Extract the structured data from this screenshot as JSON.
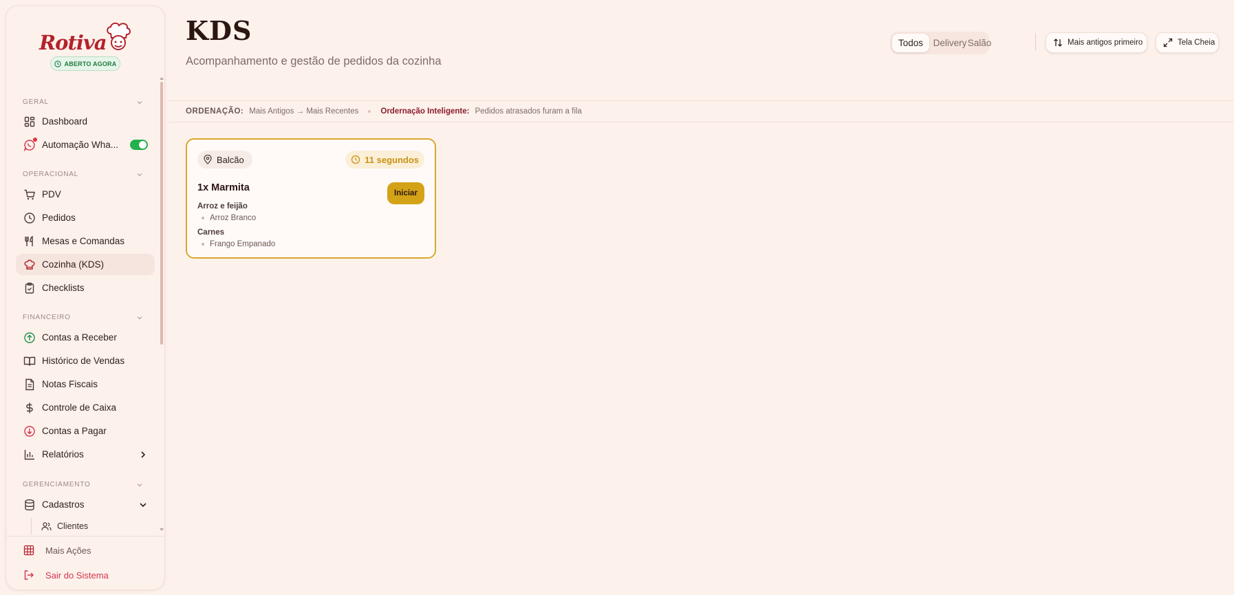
{
  "sidebar": {
    "brand": "Rotiva",
    "status_badge": "ABERTO AGORA",
    "sections": {
      "geral": "GERAL",
      "operacional": "OPERACIONAL",
      "financeiro": "FINANCEIRO",
      "gerenciamento": "GERENCIAMENTO"
    },
    "items": {
      "dashboard": "Dashboard",
      "whatsapp": "Automação Wha...",
      "pdv": "PDV",
      "pedidos": "Pedidos",
      "mesas": "Mesas e Comandas",
      "cozinha": "Cozinha (KDS)",
      "checklists": "Checklists",
      "receber": "Contas a Receber",
      "historico": "Histórico de Vendas",
      "notas": "Notas Fiscais",
      "caixa": "Controle de Caixa",
      "pagar": "Contas a Pagar",
      "relatorios": "Relatórios",
      "cadastros": "Cadastros",
      "clientes": "Clientes"
    },
    "whatsapp_enabled": true,
    "footer": {
      "more": "Mais Ações",
      "logout": "Sair do Sistema"
    }
  },
  "header": {
    "title": "KDS",
    "subtitle": "Acompanhamento e gestão de pedidos da cozinha",
    "filters": [
      "Todos",
      "Delivery",
      "Salão"
    ],
    "selected_filter": "Todos",
    "sort_label": "Mais antigos primeiro",
    "fullscreen_label": "Tela Cheia"
  },
  "ordering": {
    "label": "ORDENAÇÃO:",
    "value": "Mais Antigos → Mais Recentes",
    "smart_label": "Ordernação Inteligente:",
    "smart_value": "Pedidos atrasados furam a fila"
  },
  "order_card": {
    "location": "Balcão",
    "elapsed": "11 segundos",
    "item": "1x Marmita",
    "start_label": "Iniciar",
    "groups": [
      {
        "name": "Arroz e feijão",
        "option": "Arroz Branco"
      },
      {
        "name": "Carnes",
        "option": "Frango Empanado"
      }
    ]
  },
  "colors": {
    "accent": "#d4a217",
    "brand": "#b3232c",
    "open": "#1f7a3c",
    "logout": "#d2374a"
  }
}
